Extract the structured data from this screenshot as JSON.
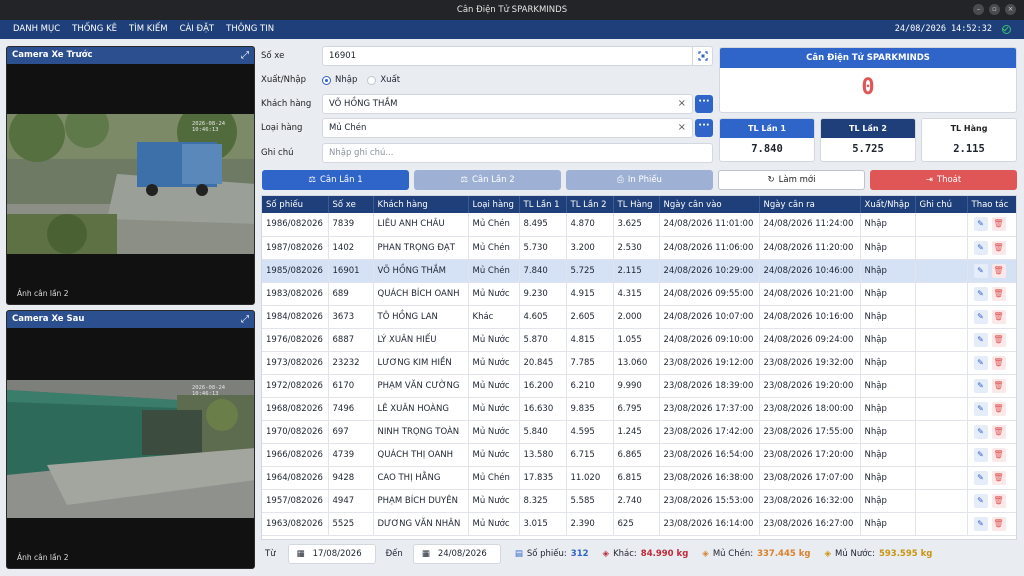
{
  "window": {
    "title": "Cân Điện Tử SPARKMINDS"
  },
  "menu": {
    "items": [
      "DANH MỤC",
      "THỐNG KÊ",
      "TÌM KIẾM",
      "CÀI ĐẶT",
      "THÔNG TIN"
    ],
    "datetime": "24/08/2026  14:52:32"
  },
  "cameras": {
    "front": {
      "title": "Camera Xe Trước",
      "label": "Ảnh cân lần 2",
      "stamp": "2026-08-24 10:46:13"
    },
    "rear": {
      "title": "Camera Xe Sau",
      "label": "Ảnh cân lần 2",
      "stamp": "2026-08-24 10:46:13"
    }
  },
  "form": {
    "plate_label": "Số xe",
    "plate_value": "16901",
    "direction_label": "Xuất/Nhập",
    "direction_in": "Nhập",
    "direction_out": "Xuất",
    "direction_selected": "Nhập",
    "customer_label": "Khách hàng",
    "customer_value": "VÕ HỒNG THẮM",
    "goods_label": "Loại hàng",
    "goods_value": "Mủ Chén",
    "note_label": "Ghi chú",
    "note_placeholder": "Nhập ghi chú..."
  },
  "brand": {
    "title": "Cân Điện Tử SPARKMINDS",
    "reading": "0"
  },
  "weights": {
    "w1_label": "TL Lần 1",
    "w1_value": "7.840",
    "w2_label": "TL Lần 2",
    "w2_value": "5.725",
    "net_label": "TL Hàng",
    "net_value": "2.115"
  },
  "actions": {
    "weigh1": "Cân Lần 1",
    "weigh2": "Cân Lần 2",
    "print": "In Phiếu",
    "refresh": "Làm mới",
    "exit": "Thoát"
  },
  "colors": {
    "primary": "#2f64c9",
    "navy": "#1e3f79",
    "danger": "#e05555",
    "disabled": "#9eb1d4",
    "selected_row": "#d5e2f6"
  },
  "table": {
    "headers": [
      "Số phiếu",
      "Số xe",
      "Khách hàng",
      "Loại hàng",
      "TL Lần 1",
      "TL Lần 2",
      "TL Hàng",
      "Ngày cân vào",
      "Ngày cân ra",
      "Xuất/Nhập",
      "Ghi chú",
      "Thao tác"
    ],
    "selected_index": 2,
    "rows": [
      [
        "1986/082026",
        "7839",
        "LIÊU ANH CHÂU",
        "Mủ Chén",
        "8.495",
        "4.870",
        "3.625",
        "24/08/2026 11:01:00",
        "24/08/2026 11:24:00",
        "Nhập",
        ""
      ],
      [
        "1987/082026",
        "1402",
        "PHAN TRỌNG ĐẠT",
        "Mủ Chén",
        "5.730",
        "3.200",
        "2.530",
        "24/08/2026 11:06:00",
        "24/08/2026 11:20:00",
        "Nhập",
        ""
      ],
      [
        "1985/082026",
        "16901",
        "VÕ HỒNG THẮM",
        "Mủ Chén",
        "7.840",
        "5.725",
        "2.115",
        "24/08/2026 10:29:00",
        "24/08/2026 10:46:00",
        "Nhập",
        ""
      ],
      [
        "1983/082026",
        "689",
        "QUÁCH BÍCH OANH",
        "Mủ Nước",
        "9.230",
        "4.915",
        "4.315",
        "24/08/2026 09:55:00",
        "24/08/2026 10:21:00",
        "Nhập",
        ""
      ],
      [
        "1984/082026",
        "3673",
        "TÔ HỒNG LAN",
        "Khác",
        "4.605",
        "2.605",
        "2.000",
        "24/08/2026 10:07:00",
        "24/08/2026 10:16:00",
        "Nhập",
        ""
      ],
      [
        "1976/082026",
        "6887",
        "LÝ XUÂN HIẾU",
        "Mủ Nước",
        "5.870",
        "4.815",
        "1.055",
        "24/08/2026 09:10:00",
        "24/08/2026 09:24:00",
        "Nhập",
        ""
      ],
      [
        "1973/082026",
        "23232",
        "LƯƠNG KIM HIỀN",
        "Mủ Nước",
        "20.845",
        "7.785",
        "13.060",
        "23/08/2026 19:12:00",
        "23/08/2026 19:32:00",
        "Nhập",
        ""
      ],
      [
        "1972/082026",
        "6170",
        "PHẠM VĂN CƯỜNG",
        "Mủ Nước",
        "16.200",
        "6.210",
        "9.990",
        "23/08/2026 18:39:00",
        "23/08/2026 19:20:00",
        "Nhập",
        ""
      ],
      [
        "1968/082026",
        "7496",
        "LÊ XUÂN HOÀNG",
        "Mủ Nước",
        "16.630",
        "9.835",
        "6.795",
        "23/08/2026 17:37:00",
        "23/08/2026 18:00:00",
        "Nhập",
        ""
      ],
      [
        "1970/082026",
        "697",
        "NINH TRỌNG TOÀN",
        "Mủ Nước",
        "5.840",
        "4.595",
        "1.245",
        "23/08/2026 17:42:00",
        "23/08/2026 17:55:00",
        "Nhập",
        ""
      ],
      [
        "1966/082026",
        "4739",
        "QUÁCH THỊ OANH",
        "Mủ Nước",
        "13.580",
        "6.715",
        "6.865",
        "23/08/2026 16:54:00",
        "23/08/2026 17:20:00",
        "Nhập",
        ""
      ],
      [
        "1964/082026",
        "9428",
        "CAO THỊ HẰNG",
        "Mủ Chén",
        "17.835",
        "11.020",
        "6.815",
        "23/08/2026 16:38:00",
        "23/08/2026 17:07:00",
        "Nhập",
        ""
      ],
      [
        "1957/082026",
        "4947",
        "PHẠM BÍCH DUYÊN",
        "Mủ Nước",
        "8.325",
        "5.585",
        "2.740",
        "23/08/2026 15:53:00",
        "23/08/2026 16:32:00",
        "Nhập",
        ""
      ],
      [
        "1963/082026",
        "5525",
        "DƯƠNG VĂN NHÂN",
        "Mủ Nước",
        "3.015",
        "2.390",
        "625",
        "23/08/2026 16:14:00",
        "23/08/2026 16:27:00",
        "Nhập",
        ""
      ]
    ]
  },
  "footer": {
    "from_label": "Từ",
    "from_date": "17/08/2026",
    "to_label": "Đến",
    "to_date": "24/08/2026",
    "tickets_label": "Số phiếu:",
    "tickets_value": "312",
    "other_label": "Khác:",
    "other_value": "84.990 kg",
    "cup_label": "Mủ Chén:",
    "cup_value": "337.445 kg",
    "latex_label": "Mủ Nước:",
    "latex_value": "593.595 kg"
  }
}
